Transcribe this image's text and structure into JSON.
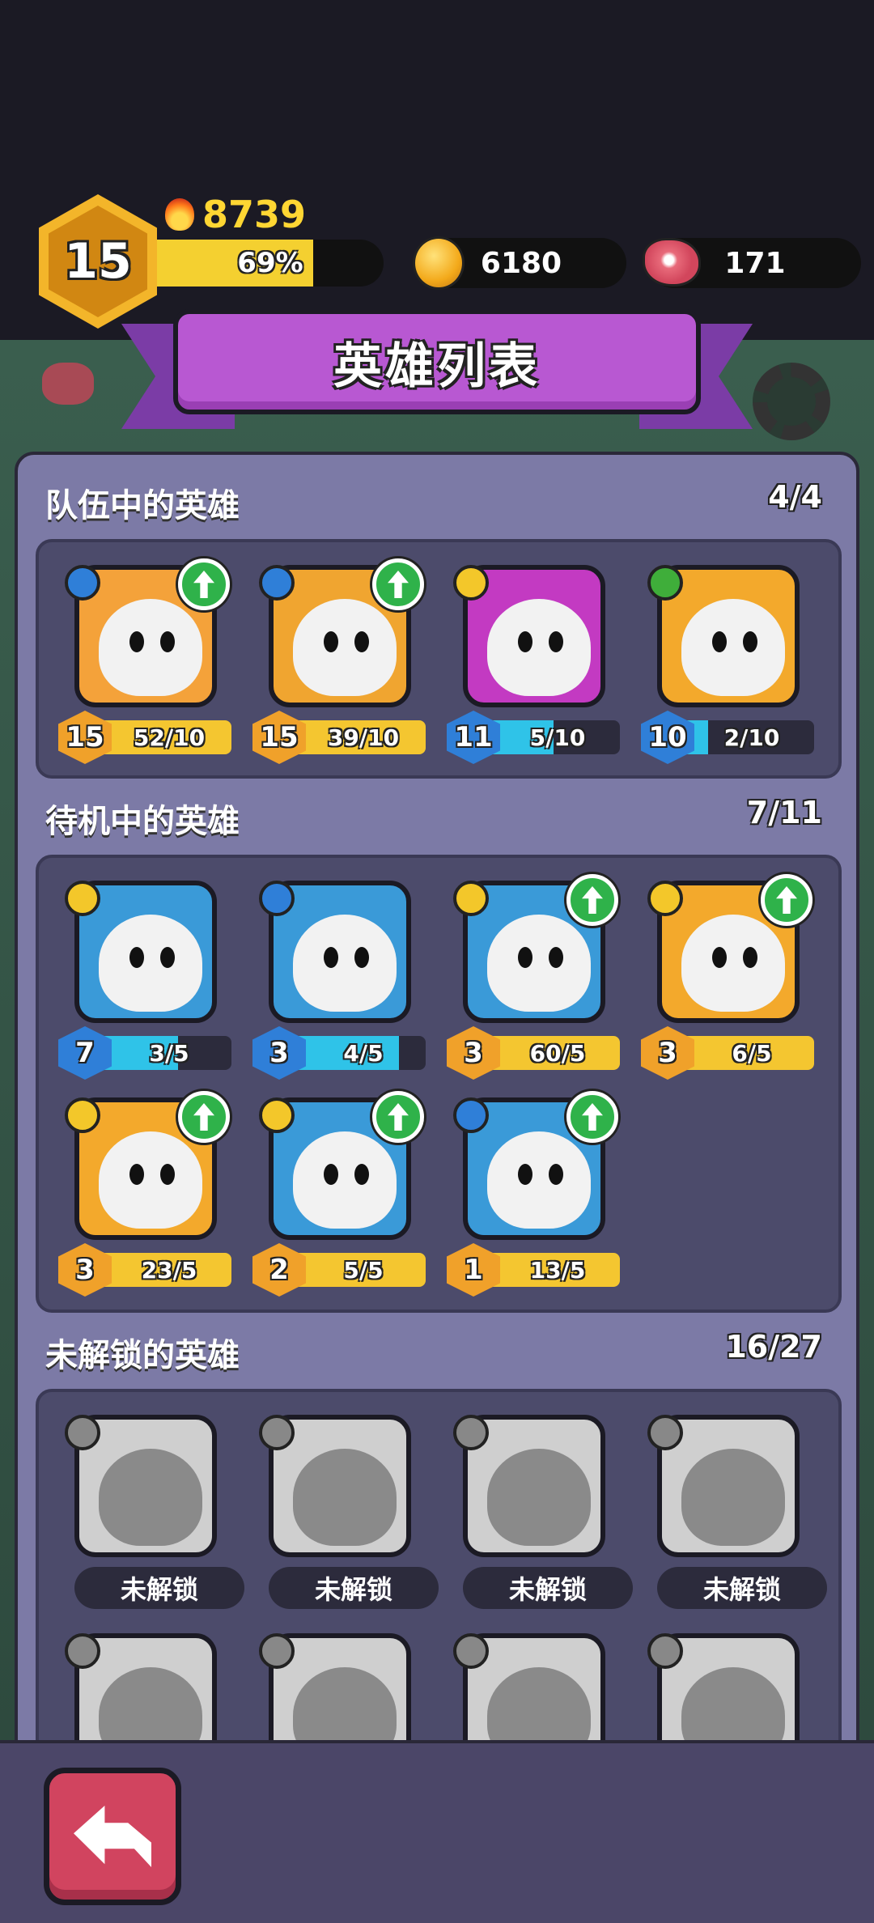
{
  "player": {
    "level": "15",
    "power": "8739",
    "xp_percent_label": "69%",
    "xp_fraction": 0.69
  },
  "resources": {
    "coins": "6180",
    "meat": "171"
  },
  "title": "英雄列表",
  "sections": {
    "team": {
      "title": "队伍中的英雄",
      "count": "4/4",
      "heroes": [
        {
          "level": "15",
          "progress": "52/10",
          "fill": 1.0,
          "bar": "yellow",
          "rank": "blue",
          "upgrade": true,
          "color": "#f4a23a"
        },
        {
          "level": "15",
          "progress": "39/10",
          "fill": 1.0,
          "bar": "yellow",
          "rank": "blue",
          "upgrade": true,
          "color": "#f0a530"
        },
        {
          "level": "11",
          "progress": "5/10",
          "fill": 0.5,
          "bar": "cyan",
          "rank": "yellow",
          "upgrade": false,
          "color": "#c33ac2"
        },
        {
          "level": "10",
          "progress": "2/10",
          "fill": 0.2,
          "bar": "cyan",
          "rank": "green",
          "upgrade": false,
          "color": "#f3a92c"
        }
      ]
    },
    "standby": {
      "title": "待机中的英雄",
      "count": "7/11",
      "heroes": [
        {
          "level": "7",
          "progress": "3/5",
          "fill": 0.6,
          "bar": "cyan",
          "rank": "yellow",
          "upgrade": false,
          "color": "#3a9ad8"
        },
        {
          "level": "3",
          "progress": "4/5",
          "fill": 0.8,
          "bar": "cyan",
          "rank": "blue",
          "upgrade": false,
          "color": "#3a9ad8"
        },
        {
          "level": "3",
          "progress": "60/5",
          "fill": 1.0,
          "bar": "yellow",
          "rank": "yellow",
          "upgrade": true,
          "color": "#3a9ad8"
        },
        {
          "level": "3",
          "progress": "6/5",
          "fill": 1.0,
          "bar": "yellow",
          "rank": "yellow",
          "upgrade": true,
          "color": "#f3a92c"
        },
        {
          "level": "3",
          "progress": "23/5",
          "fill": 1.0,
          "bar": "yellow",
          "rank": "yellow",
          "upgrade": true,
          "color": "#f3a92c"
        },
        {
          "level": "2",
          "progress": "5/5",
          "fill": 1.0,
          "bar": "yellow",
          "rank": "yellow",
          "upgrade": true,
          "color": "#3a9ad8"
        },
        {
          "level": "1",
          "progress": "13/5",
          "fill": 1.0,
          "bar": "yellow",
          "rank": "blue",
          "upgrade": true,
          "color": "#3a9ad8"
        }
      ]
    },
    "locked": {
      "title": "未解锁的英雄",
      "count": "16/27",
      "locked_label": "未解锁",
      "heroes_count_visible": 8
    }
  },
  "colors": {
    "yellow_bar": "#f4c630",
    "cyan_bar": "#2fc3e8",
    "rank_blue": "#2f7fd8",
    "rank_yellow": "#f3c72a",
    "rank_green": "#3fae3a",
    "level_orange": "#f0a12a",
    "level_blue": "#2f7fd8"
  }
}
